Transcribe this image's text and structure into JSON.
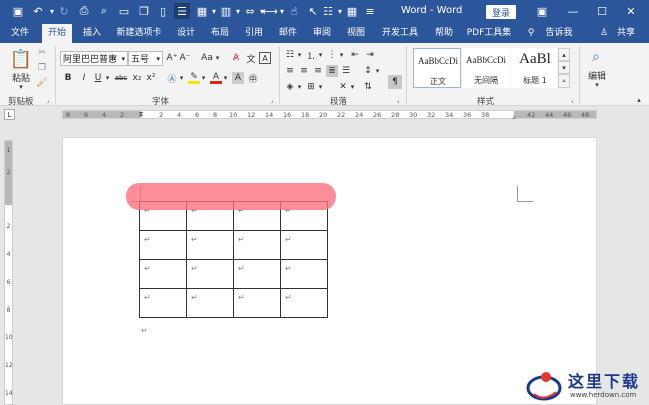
{
  "titlebar": {
    "doc_title": "Word - Word",
    "login_label": "登录"
  },
  "tabs": [
    "文件",
    "开始",
    "插入",
    "新建选项卡",
    "设计",
    "布局",
    "引用",
    "邮件",
    "审阅",
    "视图",
    "开发工具",
    "帮助",
    "PDF工具集",
    "告诉我",
    "共享"
  ],
  "ribbon": {
    "paste_label": "粘贴",
    "font_name": "阿里巴巴普惠",
    "font_size": "五号",
    "aa_label": "Aa",
    "groups": {
      "clipboard": "剪贴板",
      "font": "字体",
      "paragraph": "段落",
      "styles": "样式"
    },
    "styles": [
      {
        "sample": "AaBbCcDi",
        "name": "正文"
      },
      {
        "sample": "AaBbCcDi",
        "name": "无间隔"
      },
      {
        "sample": "AaBl",
        "name": "标题 1"
      }
    ],
    "edit_label": "编辑"
  },
  "ruler": {
    "numbers": [
      "8",
      "6",
      "4",
      "2",
      "2",
      "4",
      "6",
      "8",
      "10",
      "12",
      "14",
      "16",
      "18",
      "20",
      "22",
      "24",
      "26",
      "28",
      "30",
      "32",
      "34",
      "36",
      "38",
      "42",
      "44",
      "46",
      "48"
    ],
    "v_numbers": [
      "1",
      "2",
      "2",
      "4",
      "6",
      "8",
      "10",
      "12",
      "14"
    ]
  },
  "table": {
    "rows": 4,
    "cols": 4,
    "cell_mark": "↵"
  },
  "paragraph_mark": "↵",
  "watermark": {
    "text": "这里下载",
    "url": "www.herdown.com"
  },
  "colors": {
    "accent": "#2b579a",
    "highlight": "#fa6e78"
  }
}
